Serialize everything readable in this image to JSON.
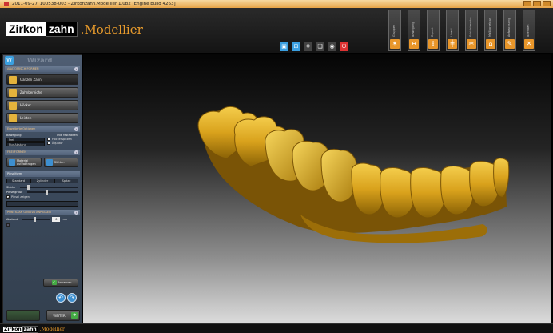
{
  "window": {
    "title": "2011-09-27_100538-003 - Zirkonzahn.Modellier 1.0b2 [Engine build 4263]"
  },
  "brand": {
    "logo_part1": "Zirkon",
    "logo_part2": "zahn",
    "product": ".Modellier",
    "accent": "#e89b2c"
  },
  "tool_tabs": [
    {
      "label": "Gruppen",
      "icon": "group-icon"
    },
    {
      "label": "Bewegung",
      "icon": "move-icon"
    },
    {
      "label": "Export",
      "icon": "export-icon"
    },
    {
      "label": "Lineal",
      "icon": "ruler-icon"
    },
    {
      "label": "Schichtmodus",
      "icon": "layer-icon"
    },
    {
      "label": "Maßkorrektur",
      "icon": "measure-icon"
    },
    {
      "label": "Aufwachsung",
      "icon": "wax-icon"
    },
    {
      "label": "Beenden",
      "icon": "exit-icon"
    }
  ],
  "toolbar": [
    {
      "name": "view-icon",
      "color": "#3a9fe0",
      "glyph": "▣"
    },
    {
      "name": "grid-icon",
      "color": "#3a9fe0",
      "glyph": "⊞"
    },
    {
      "name": "pan-icon",
      "color": "#444",
      "glyph": "✥"
    },
    {
      "name": "layers-icon",
      "color": "#444",
      "glyph": "❑"
    },
    {
      "name": "camera-icon",
      "color": "#444",
      "glyph": "◉"
    },
    {
      "name": "power-icon",
      "color": "#d33",
      "glyph": "⏻"
    }
  ],
  "wizard": {
    "title": "Wizard",
    "sections": {
      "anatomy": "ANATOMISCH FORMEN",
      "extended": "Erweiterte Optionen",
      "freeform": "FREI FORMEN",
      "pontic": "PONTIC AN GINGIVA ANPASSEN"
    },
    "anatomy_buttons": [
      "Ganzen Zahn",
      "Zahnbereiche",
      "Höcker",
      "Leisten"
    ],
    "extended": {
      "movement_label": "Bewegung:",
      "movement_value": "Frei",
      "dropdown_value": "Nur Abstand",
      "parts_label": "Teile festhalten:",
      "parts": [
        "Höckerspitzen",
        "Äquator"
      ]
    },
    "freeform_buttons": [
      "Material auf-/abtragen",
      "Glätten"
    ],
    "brush_shape_header": "Pinselform",
    "brush_shapes": [
      "Standard",
      "Zylinder",
      "Spitze"
    ],
    "strength_label": "Stärke",
    "strength_value": 0.12,
    "brush_size_label": "Pinselgröße",
    "brush_size_value": 0.35,
    "show_brush": "Pinsel zeigen",
    "show_brush_checked": true,
    "distance_label": "Abstand",
    "distance_value": "0",
    "distance_unit": "mm",
    "distance_slider": 0.4,
    "apply_label": "Anpassen",
    "back_label": "",
    "next_label": "WEITER"
  },
  "status": {
    "logo_part1": "Zirkon",
    "logo_part2": "zahn",
    "product": ".Modellier"
  }
}
